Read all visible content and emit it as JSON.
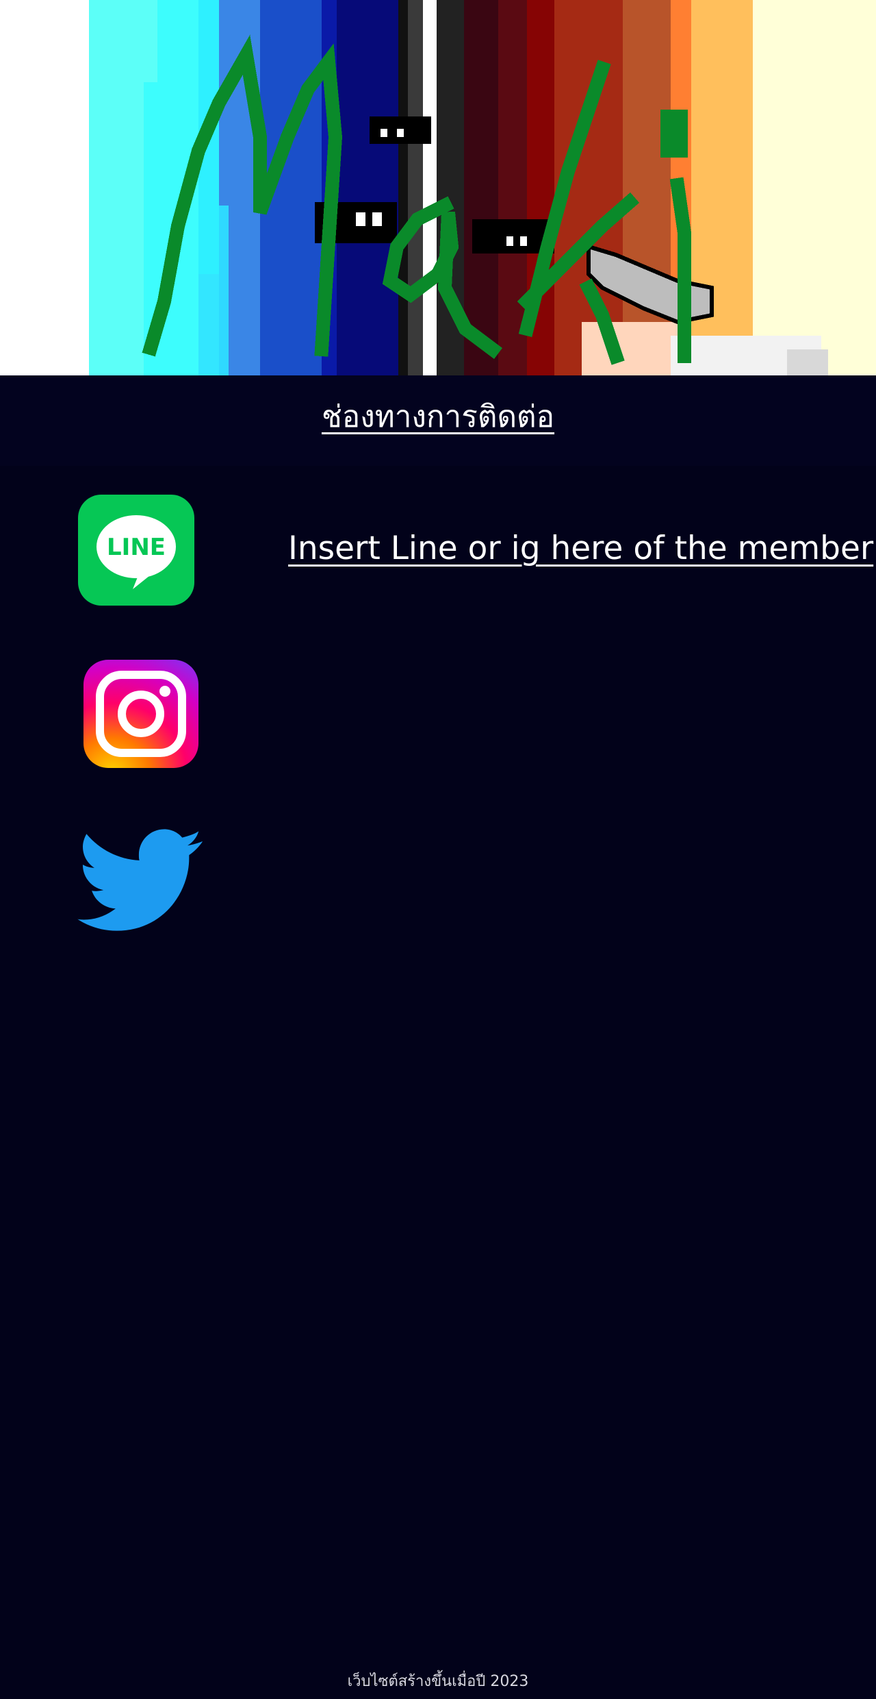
{
  "banner": {
    "signature_text": "Maki",
    "colors": {
      "signature": "#0a8a2a"
    }
  },
  "contact": {
    "title": "ช่องทางการติดต่อ",
    "member_text": "Insert Line or ig here of the member"
  },
  "socials": [
    {
      "name": "line",
      "label": "LINE",
      "icon": "line-icon",
      "color": "#06c755"
    },
    {
      "name": "instagram",
      "icon": "instagram-icon",
      "color": "#e1306c"
    },
    {
      "name": "twitter",
      "icon": "twitter-bird-icon",
      "color": "#1d9bf0"
    }
  ],
  "footer": {
    "text": "เว็บไซต์สร้างขึ้นเมื่อปี 2023"
  },
  "theme": {
    "background": "#02021a"
  }
}
